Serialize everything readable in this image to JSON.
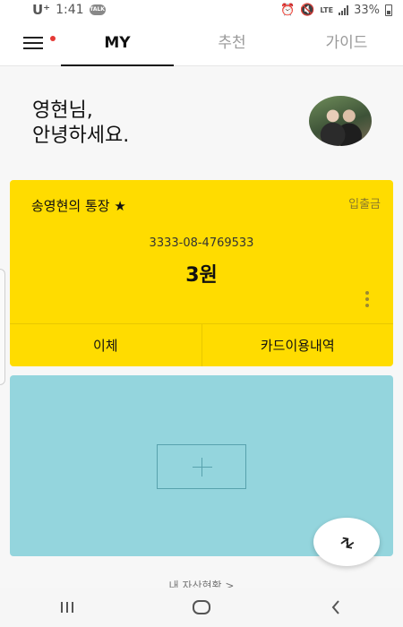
{
  "status_bar": {
    "carrier": "U⁺",
    "time": "1:41",
    "talk_badge": "TALK",
    "network": "LTE",
    "battery": "33%"
  },
  "nav": {
    "tabs": [
      {
        "label": "MY",
        "active": true
      },
      {
        "label": "추천",
        "active": false
      },
      {
        "label": "가이드",
        "active": false
      }
    ],
    "has_notification": true
  },
  "greeting": {
    "line1": "영현님,",
    "line2": "안녕하세요."
  },
  "account": {
    "name": "송영현의 통장 ★",
    "deposit_label": "입출금",
    "number": "3333-08-4769533",
    "balance": "3원",
    "actions": [
      "이체",
      "카드이용내역"
    ],
    "card_color": "#ffdc00"
  },
  "add_card": {
    "color": "#94d5dd",
    "icon": "plus-icon"
  },
  "fab": {
    "icon": "swap-arrows-icon"
  },
  "bottom_link": "내 자산현황 >",
  "system_nav": {
    "icons": [
      "recent-apps-icon",
      "home-icon",
      "back-icon"
    ]
  }
}
